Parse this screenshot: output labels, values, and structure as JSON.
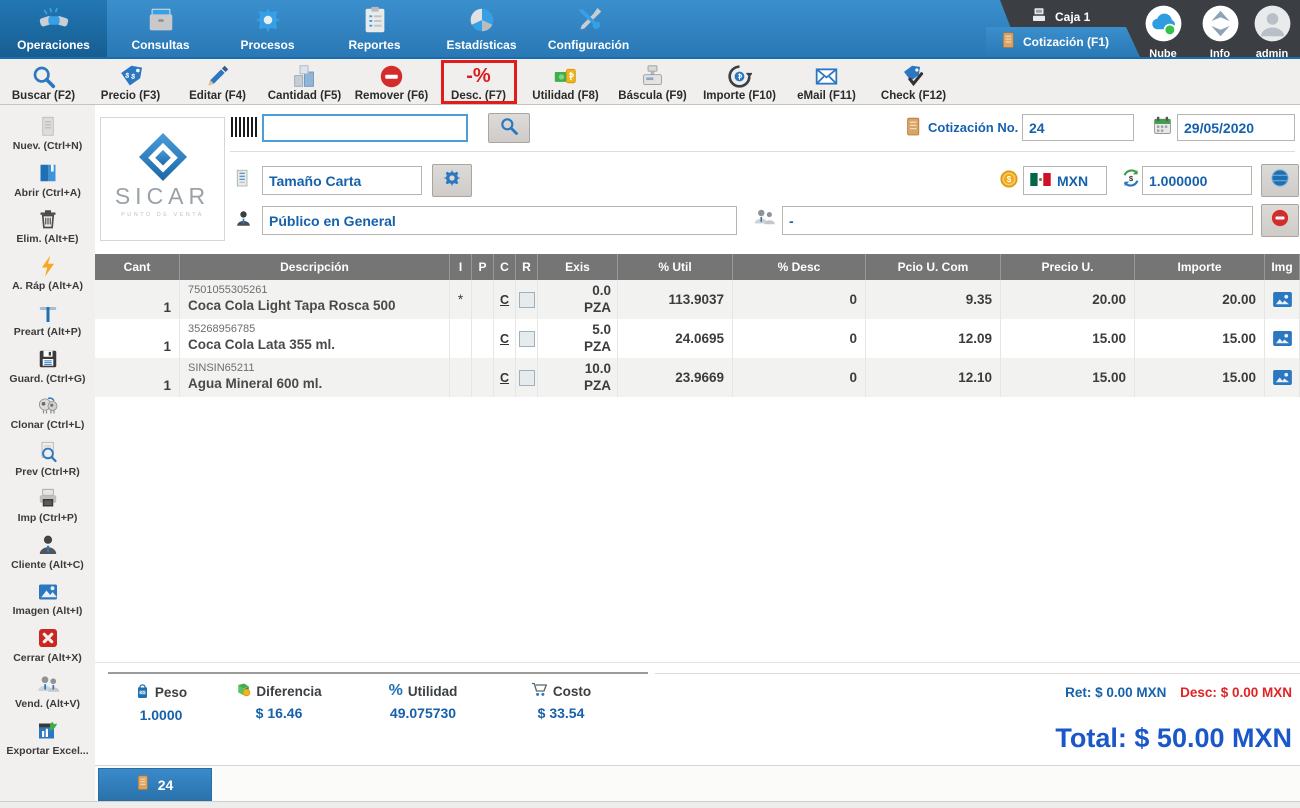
{
  "menu": {
    "items": [
      {
        "label": "Operaciones",
        "icon": "handshake-icon",
        "selected": true
      },
      {
        "label": "Consultas",
        "icon": "archive-icon",
        "selected": false
      },
      {
        "label": "Procesos",
        "icon": "gear-icon",
        "selected": false
      },
      {
        "label": "Reportes",
        "icon": "report-icon",
        "selected": false
      },
      {
        "label": "Estadísticas",
        "icon": "pie-chart-icon",
        "selected": false
      },
      {
        "label": "Configuración",
        "icon": "tools-icon",
        "selected": false
      }
    ]
  },
  "session": {
    "station": "Caja 1",
    "active_tab": "Cotización (F1)",
    "cloud_label": "Nube",
    "info_label": "Info",
    "user": "admin"
  },
  "toolbar": {
    "items": [
      {
        "label": "Buscar (F2)",
        "icon": "search-icon"
      },
      {
        "label": "Precio (F3)",
        "icon": "price-tag-icon"
      },
      {
        "label": "Editar (F4)",
        "icon": "pencil-icon"
      },
      {
        "label": "Cantidad (F5)",
        "icon": "quantity-icon"
      },
      {
        "label": "Remover (F6)",
        "icon": "remove-icon"
      },
      {
        "label": "Desc. (F7)",
        "icon": "discount-icon",
        "highlighted": true
      },
      {
        "label": "Utilidad (F8)",
        "icon": "profit-icon"
      },
      {
        "label": "Báscula (F9)",
        "icon": "scale-icon"
      },
      {
        "label": "Importe (F10)",
        "icon": "amount-icon"
      },
      {
        "label": "eMail (F11)",
        "icon": "email-icon"
      },
      {
        "label": "Check (F12)",
        "icon": "check-icon"
      }
    ]
  },
  "icons": {
    "discount_glyph": "-%",
    "percent_glyph": "%"
  },
  "sidebar": {
    "items": [
      {
        "label": "Nuev. (Ctrl+N)",
        "icon": "new-document-icon"
      },
      {
        "label": "Abrir (Ctrl+A)",
        "icon": "open-icon"
      },
      {
        "label": "Elim. (Alt+E)",
        "icon": "trash-icon"
      },
      {
        "label": "A. Ráp (Alt+A)",
        "icon": "lightning-icon"
      },
      {
        "label": "Preart (Alt+P)",
        "icon": "preart-icon"
      },
      {
        "label": "Guard. (Ctrl+G)",
        "icon": "save-icon"
      },
      {
        "label": "Clonar (Ctrl+L)",
        "icon": "clone-icon"
      },
      {
        "label": "Prev (Ctrl+R)",
        "icon": "preview-icon"
      },
      {
        "label": "Imp (Ctrl+P)",
        "icon": "print-icon"
      },
      {
        "label": "Cliente (Alt+C)",
        "icon": "client-icon"
      },
      {
        "label": "Imagen (Alt+I)",
        "icon": "image-icon"
      },
      {
        "label": "Cerrar (Alt+X)",
        "icon": "close-icon"
      },
      {
        "label": "Vend. (Alt+V)",
        "icon": "vendors-icon"
      },
      {
        "label": "Exportar Excel...",
        "icon": "excel-icon"
      }
    ]
  },
  "logo": {
    "name": "SICAR",
    "tagline": "PUNTO DE VENTA"
  },
  "form": {
    "barcode_value": "",
    "search_format_value": "Tamaño Carta",
    "customer_value": "Público en General",
    "vendor_value": "-",
    "quote_label": "Cotización No.",
    "quote_number": "24",
    "date_value": "29/05/2020",
    "currency_code": "MXN",
    "exchange_rate": "1.000000"
  },
  "table": {
    "columns": [
      "Cant",
      "Descripción",
      "I",
      "P",
      "C",
      "R",
      "Exis",
      "% Util",
      "% Desc",
      "Pcio U. Com",
      "Precio U.",
      "Importe",
      "Img"
    ],
    "rows": [
      {
        "cant": "1",
        "code": "7501055305261",
        "name": "Coca Cola Light Tapa Rosca 500",
        "i": "*",
        "p": "",
        "c": "C",
        "exis": "0.0",
        "unit": "PZA",
        "util": "113.9037",
        "desc": "0",
        "pcio_com": "9.35",
        "precio": "20.00",
        "importe": "20.00"
      },
      {
        "cant": "1",
        "code": "35268956785",
        "name": "Coca Cola Lata 355 ml.",
        "i": "",
        "p": "",
        "c": "C",
        "exis": "5.0",
        "unit": "PZA",
        "util": "24.0695",
        "desc": "0",
        "pcio_com": "12.09",
        "precio": "15.00",
        "importe": "15.00"
      },
      {
        "cant": "1",
        "code": "SINSIN65211",
        "name": "Agua Mineral 600 ml.",
        "i": "",
        "p": "",
        "c": "C",
        "exis": "10.0",
        "unit": "PZA",
        "util": "23.9669",
        "desc": "0",
        "pcio_com": "12.10",
        "precio": "15.00",
        "importe": "15.00"
      }
    ]
  },
  "summary": {
    "metrics": [
      {
        "label": "Peso",
        "value": "1.0000",
        "icon": "weight-bag-icon"
      },
      {
        "label": "Diferencia",
        "value": "$ 16.46",
        "icon": "difference-money-icon"
      },
      {
        "label": "Utilidad",
        "value": "49.075730",
        "icon": "percent-icon"
      },
      {
        "label": "Costo",
        "value": "$ 33.54",
        "icon": "cost-cart-icon"
      }
    ],
    "ret_label": "Ret:",
    "ret_value": "$ 0.00 MXN",
    "desc_label": "Desc:",
    "desc_value": "$ 0.00 MXN",
    "total_label": "Total:",
    "total_value": "$ 50.00 MXN"
  },
  "footer": {
    "tab_label": "24"
  }
}
